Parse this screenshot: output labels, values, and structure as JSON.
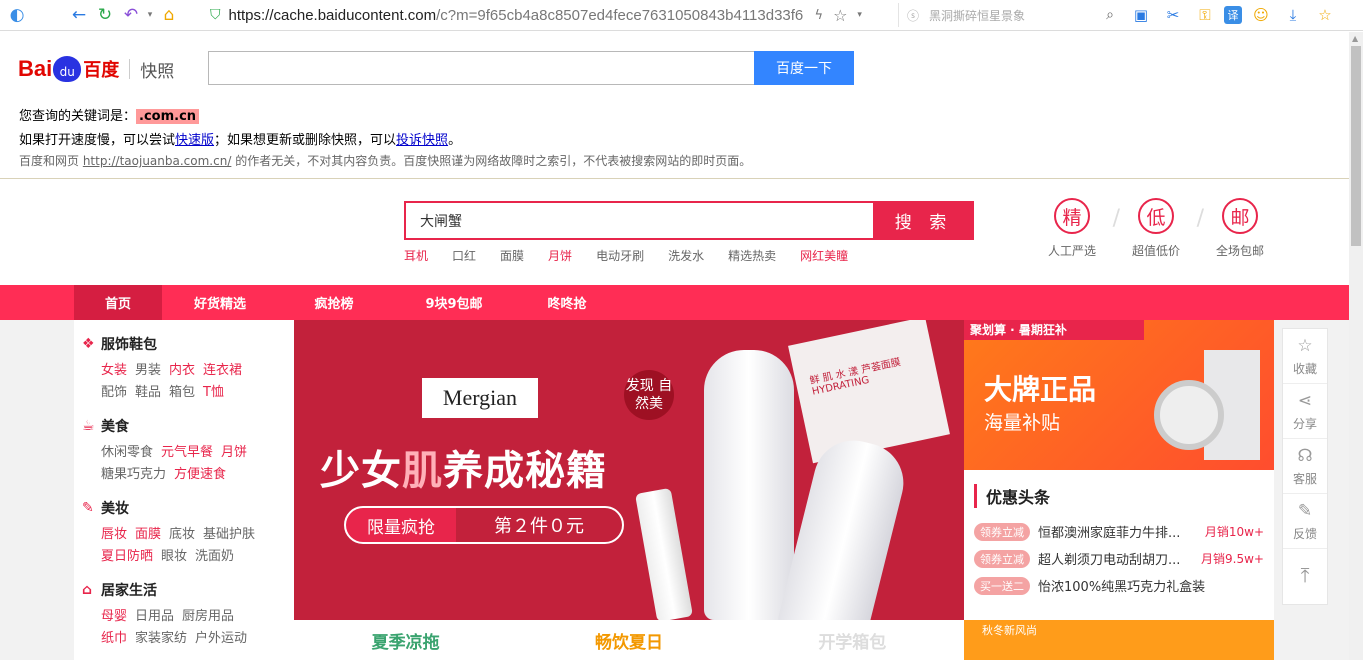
{
  "browser": {
    "url_main": "https://cache.baiducontent.com",
    "url_rest": "/c?m=9f65cb4a8c8507ed4fece7631050843b4113d33f6",
    "search_placeholder": "黑洞撕碎恒星景象"
  },
  "snapshot": {
    "logo_bai": "Bai",
    "logo_du": "百度",
    "logo_snapshot": "快照",
    "search_button": "百度一下",
    "keyword_prefix": "您查询的关键词是：",
    "keyword": ".com.cn",
    "line2_a": "如果打开速度慢，可以尝试",
    "line2_link1": "快速版",
    "line2_b": "；如果想更新或删除快照，可以",
    "line2_link2": "投诉快照",
    "line2_c": "。",
    "line3_a": "百度和网页 ",
    "line3_link": "http://taojuanba.com.cn/",
    "line3_b": " 的作者无关，不对其内容负责。百度快照谨为网络故障时之索引，不代表被搜索网站的即时页面。"
  },
  "shop": {
    "search_value": "大闸蟹",
    "search_button": "搜 索",
    "hot_words": [
      {
        "text": "耳机",
        "red": true
      },
      {
        "text": "口红",
        "red": false
      },
      {
        "text": "面膜",
        "red": false
      },
      {
        "text": "月饼",
        "red": true
      },
      {
        "text": "电动牙刷",
        "red": false
      },
      {
        "text": "洗发水",
        "red": false
      },
      {
        "text": "精选热卖",
        "red": false
      },
      {
        "text": "网红美瞳",
        "red": true
      }
    ],
    "badges": [
      {
        "char": "精",
        "label": "人工严选"
      },
      {
        "char": "低",
        "label": "超值低价"
      },
      {
        "char": "邮",
        "label": "全场包邮"
      }
    ],
    "nav": [
      "首页",
      "好货精选",
      "疯抢榜",
      "9块9包邮",
      "咚咚抢"
    ]
  },
  "categories": [
    {
      "title": "服饰鞋包",
      "rows": [
        [
          "女装|r",
          "男装",
          "内衣|r",
          "连衣裙|r"
        ],
        [
          "配饰",
          "鞋品",
          "箱包",
          "T恤|r"
        ]
      ]
    },
    {
      "title": "美食",
      "rows": [
        [
          "休闲零食",
          "元气早餐|r",
          "月饼|r"
        ],
        [
          "糖果巧克力",
          "方便速食|r"
        ]
      ]
    },
    {
      "title": "美妆",
      "rows": [
        [
          "唇妆|r",
          "面膜|r",
          "底妆",
          "基础护肤"
        ],
        [
          "夏日防晒|r",
          "眼妆",
          "洗面奶"
        ]
      ]
    },
    {
      "title": "居家生活",
      "rows": [
        [
          "母婴|r",
          "日用品",
          "厨房用品"
        ],
        [
          "纸巾|r",
          "家装家纺",
          "户外运动"
        ]
      ]
    }
  ],
  "banner": {
    "brand": "Mergian",
    "circle": "发现 自然美",
    "title_a": "少女",
    "title_b": "肌",
    "title_c": "养成秘籍",
    "pill_left": "限量疯抢",
    "pill_right": "第２件０元",
    "mask_text": "鲜 肌 水 漾 芦荟面膜 HYDRATING"
  },
  "strip": [
    "夏季凉拖",
    "畅饮夏日",
    "开学箱包"
  ],
  "promo": {
    "top": "聚划算 · 暑期狂补",
    "big": "大牌正品",
    "sub": "海量补贴"
  },
  "news": {
    "title": "优惠头条",
    "items": [
      {
        "tag": "领券立减",
        "text": "恒都澳洲家庭菲力牛排...",
        "sales": "月销10w+"
      },
      {
        "tag": "领券立减",
        "text": "超人剃须刀电动刮胡刀...",
        "sales": "月销9.5w+"
      },
      {
        "tag": "买一送二",
        "text": "怡浓100%纯黑巧克力礼盒装",
        "sales": ""
      }
    ]
  },
  "promo2": "秋冬新风尚",
  "side": [
    "收藏",
    "分享",
    "客服",
    "反馈"
  ]
}
